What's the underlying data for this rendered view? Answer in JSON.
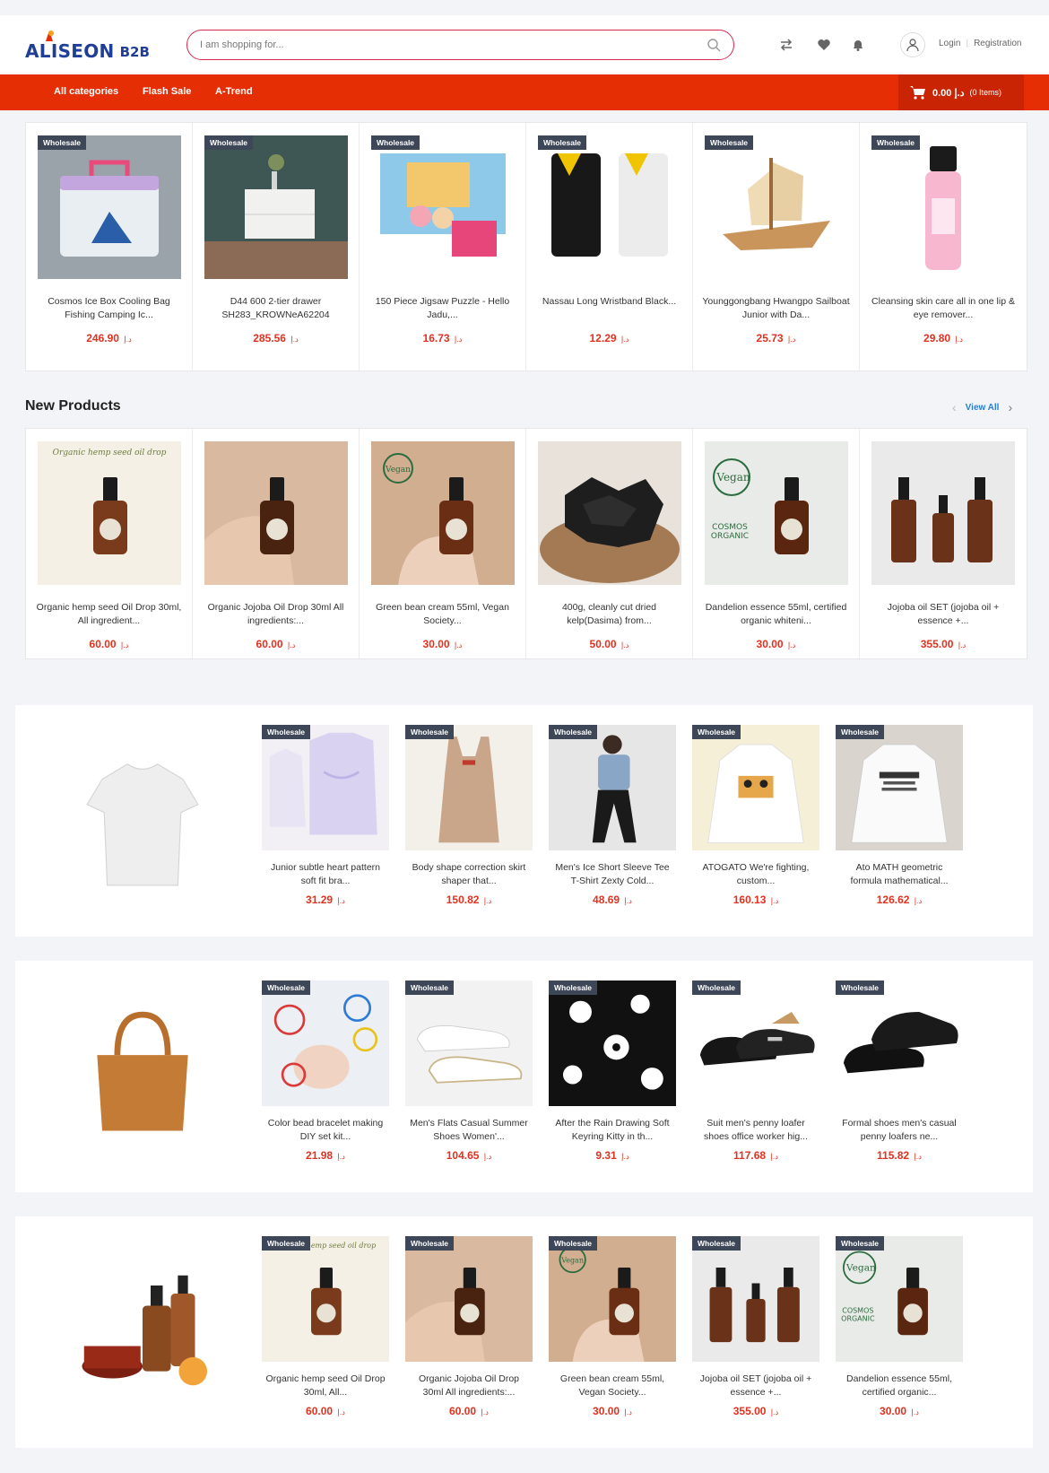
{
  "brand": {
    "name": "ALISEON",
    "suffix": "B2B",
    "color": "#1f3f97"
  },
  "search": {
    "placeholder": "I am shopping for..."
  },
  "header": {
    "login": "Login",
    "registration": "Registration"
  },
  "nav": {
    "items": [
      "All categories",
      "Flash Sale",
      "A-Trend"
    ],
    "cart_amount": "0.00 د.إ",
    "cart_items": "(0 Items)",
    "color": "#e62e05"
  },
  "currency": "د.إ",
  "badge_label": "Wholesale",
  "top_products": [
    {
      "name": "Cosmos Ice Box Cooling Bag Fishing Camping Ic...",
      "price": "246.90",
      "icon": "cooler-box"
    },
    {
      "name": "D44 600 2-tier drawer SH283_KROWNeA62204",
      "price": "285.56",
      "icon": "drawer"
    },
    {
      "name": "150 Piece Jigsaw Puzzle - Hello Jadu,...",
      "price": "16.73",
      "icon": "puzzle"
    },
    {
      "name": "Nassau Long Wristband Black...",
      "price": "12.29",
      "icon": "wristband"
    },
    {
      "name": "Younggongbang Hwangpo Sailboat Junior with Da...",
      "price": "25.73",
      "icon": "sailboat"
    },
    {
      "name": "Cleansing skin care all in one lip & eye remover...",
      "price": "29.80",
      "icon": "cleanser-bottle"
    }
  ],
  "new_products": {
    "title": "New Products",
    "view_all": "View All",
    "items": [
      {
        "name": "Organic hemp seed Oil Drop 30ml, All ingredient...",
        "price": "60.00",
        "icon": "dropper-bottle",
        "label_top": "Organic hemp seed oil drop"
      },
      {
        "name": "Organic Jojoba Oil Drop 30ml All ingredients:...",
        "price": "60.00",
        "icon": "dropper-hand"
      },
      {
        "name": "Green bean cream 55ml, Vegan Society...",
        "price": "30.00",
        "icon": "vegan-bottle-hand"
      },
      {
        "name": "400g, cleanly cut dried kelp(Dasima) from...",
        "price": "50.00",
        "icon": "kelp"
      },
      {
        "name": "Dandelion essence 55ml, certified organic whiteni...",
        "price": "30.00",
        "icon": "vegan-bottle"
      },
      {
        "name": "Jojoba oil SET (jojoba oil + essence +...",
        "price": "355.00",
        "icon": "bottle-set"
      }
    ]
  },
  "category_rows": [
    {
      "hero_icon": "t-shirt",
      "items": [
        {
          "name": "Junior subtle heart pattern soft fit bra...",
          "price": "31.29",
          "icon": "tank-tops"
        },
        {
          "name": "Body shape correction skirt shaper that...",
          "price": "150.82",
          "icon": "shaper"
        },
        {
          "name": "Men's Ice Short Sleeve Tee T-Shirt Zexty Cold...",
          "price": "48.69",
          "icon": "man-seated"
        },
        {
          "name": "ATOGATO We're fighting, custom...",
          "price": "160.13",
          "icon": "hoodie-print"
        },
        {
          "name": "Ato MATH geometric formula mathematical...",
          "price": "126.62",
          "icon": "hoodie-math"
        }
      ]
    },
    {
      "hero_icon": "handbag",
      "items": [
        {
          "name": "Color bead bracelet making DIY set kit...",
          "price": "21.98",
          "icon": "bracelets"
        },
        {
          "name": "Men's Flats Casual Summer Shoes Women'...",
          "price": "104.65",
          "icon": "slip-on-shoes"
        },
        {
          "name": "After the Rain Drawing Soft Keyring Kitty in th...",
          "price": "9.31",
          "icon": "keyring-pattern"
        },
        {
          "name": "Suit men's penny loafer shoes office worker hig...",
          "price": "117.68",
          "icon": "loafers"
        },
        {
          "name": "Formal shoes men's casual penny loafers ne...",
          "price": "115.82",
          "icon": "loafers-black"
        }
      ]
    },
    {
      "hero_icon": "cosmetics",
      "items": [
        {
          "name": "Organic hemp seed Oil Drop 30ml, All...",
          "price": "60.00",
          "icon": "dropper-bottle",
          "label_top": "Organic hemp seed oil drop"
        },
        {
          "name": "Organic Jojoba Oil Drop 30ml All ingredients:...",
          "price": "60.00",
          "icon": "dropper-hand"
        },
        {
          "name": "Green bean cream 55ml, Vegan Society...",
          "price": "30.00",
          "icon": "vegan-bottle-hand"
        },
        {
          "name": "Jojoba oil SET (jojoba oil + essence +...",
          "price": "355.00",
          "icon": "bottle-set"
        },
        {
          "name": "Dandelion essence 55ml, certified organic...",
          "price": "30.00",
          "icon": "vegan-bottle"
        }
      ]
    }
  ]
}
